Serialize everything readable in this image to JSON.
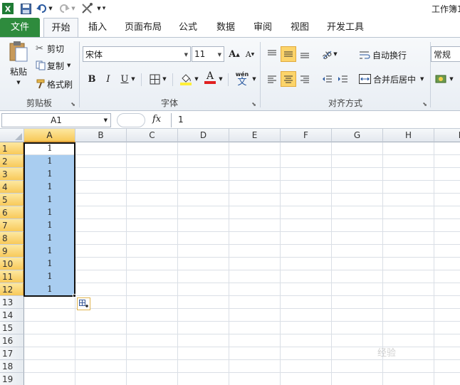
{
  "window": {
    "title": "工作簿1"
  },
  "quick_access": {
    "icons": [
      "excel-logo-icon",
      "save-icon",
      "undo-icon",
      "redo-icon",
      "tools-icon",
      "customize-icon"
    ]
  },
  "tabs": [
    {
      "label": "文件"
    },
    {
      "label": "开始"
    },
    {
      "label": "插入"
    },
    {
      "label": "页面布局"
    },
    {
      "label": "公式"
    },
    {
      "label": "数据"
    },
    {
      "label": "审阅"
    },
    {
      "label": "视图"
    },
    {
      "label": "开发工具"
    }
  ],
  "clipboard": {
    "paste": "粘贴",
    "cut": "剪切",
    "copy": "复制",
    "format_painter": "格式刷",
    "group_label": "剪贴板"
  },
  "font": {
    "name": "宋体",
    "size": "11",
    "bold": "B",
    "italic": "I",
    "underline": "U",
    "grow": "A",
    "shrink": "A",
    "font_color": "A",
    "phonetic_top": "wén",
    "phonetic_bottom": "文",
    "group_label": "字体"
  },
  "alignment": {
    "wrap_text": "自动换行",
    "merge_center": "合并后居中",
    "group_label": "对齐方式"
  },
  "number": {
    "format": "常规"
  },
  "formula_bar": {
    "name_box": "A1",
    "fx": "fx",
    "value": "1"
  },
  "grid": {
    "columns": [
      "A",
      "B",
      "C",
      "D",
      "E",
      "F",
      "G",
      "H",
      "I"
    ],
    "rows": [
      "1",
      "2",
      "3",
      "4",
      "5",
      "6",
      "7",
      "8",
      "9",
      "10",
      "11",
      "12",
      "13",
      "14",
      "15",
      "16",
      "17",
      "18",
      "19"
    ],
    "column_a_values": [
      "1",
      "1",
      "1",
      "1",
      "1",
      "1",
      "1",
      "1",
      "1",
      "1",
      "1",
      "1"
    ]
  },
  "watermark": "经验"
}
